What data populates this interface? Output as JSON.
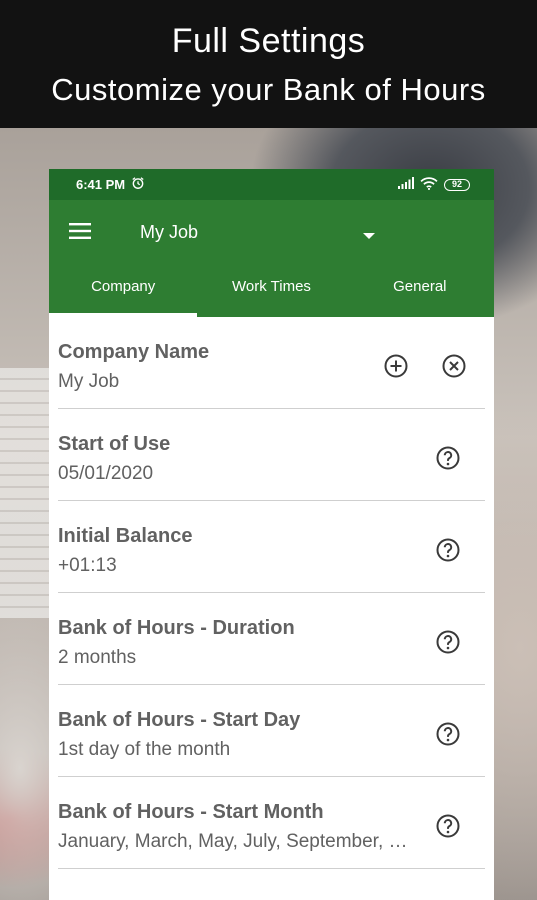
{
  "promo": {
    "title": "Full Settings",
    "subtitle": "Customize your Bank of Hours"
  },
  "status_bar": {
    "time": "6:41 PM",
    "battery": "92",
    "icons": [
      "alarm-icon",
      "signal-icon",
      "wifi-icon",
      "battery-icon"
    ]
  },
  "app_bar": {
    "title": "My Job",
    "menu_icon": "hamburger-menu-icon",
    "dropdown_icon": "dropdown-arrow-icon"
  },
  "tabs": [
    {
      "label": "Company",
      "active": true
    },
    {
      "label": "Work Times",
      "active": false
    },
    {
      "label": "General",
      "active": false
    }
  ],
  "settings": [
    {
      "label": "Company Name",
      "value": "My Job",
      "actions": [
        "add-icon",
        "remove-icon"
      ]
    },
    {
      "label": "Start of Use",
      "value": "05/01/2020",
      "actions": [
        "help-icon"
      ]
    },
    {
      "label": "Initial Balance",
      "value": "+01:13",
      "actions": [
        "help-icon"
      ]
    },
    {
      "label": "Bank of Hours - Duration",
      "value": "2 months",
      "actions": [
        "help-icon"
      ]
    },
    {
      "label": "Bank of Hours - Start Day",
      "value": "1st day of the month",
      "actions": [
        "help-icon"
      ]
    },
    {
      "label": "Bank of Hours - Start Month",
      "value": "January, March, May, July, September, November",
      "actions": [
        "help-icon"
      ]
    }
  ],
  "colors": {
    "primary": "#2e7d32",
    "status_bar": "#1f6b29",
    "header_bg": "#121212",
    "text_secondary": "#616161"
  }
}
